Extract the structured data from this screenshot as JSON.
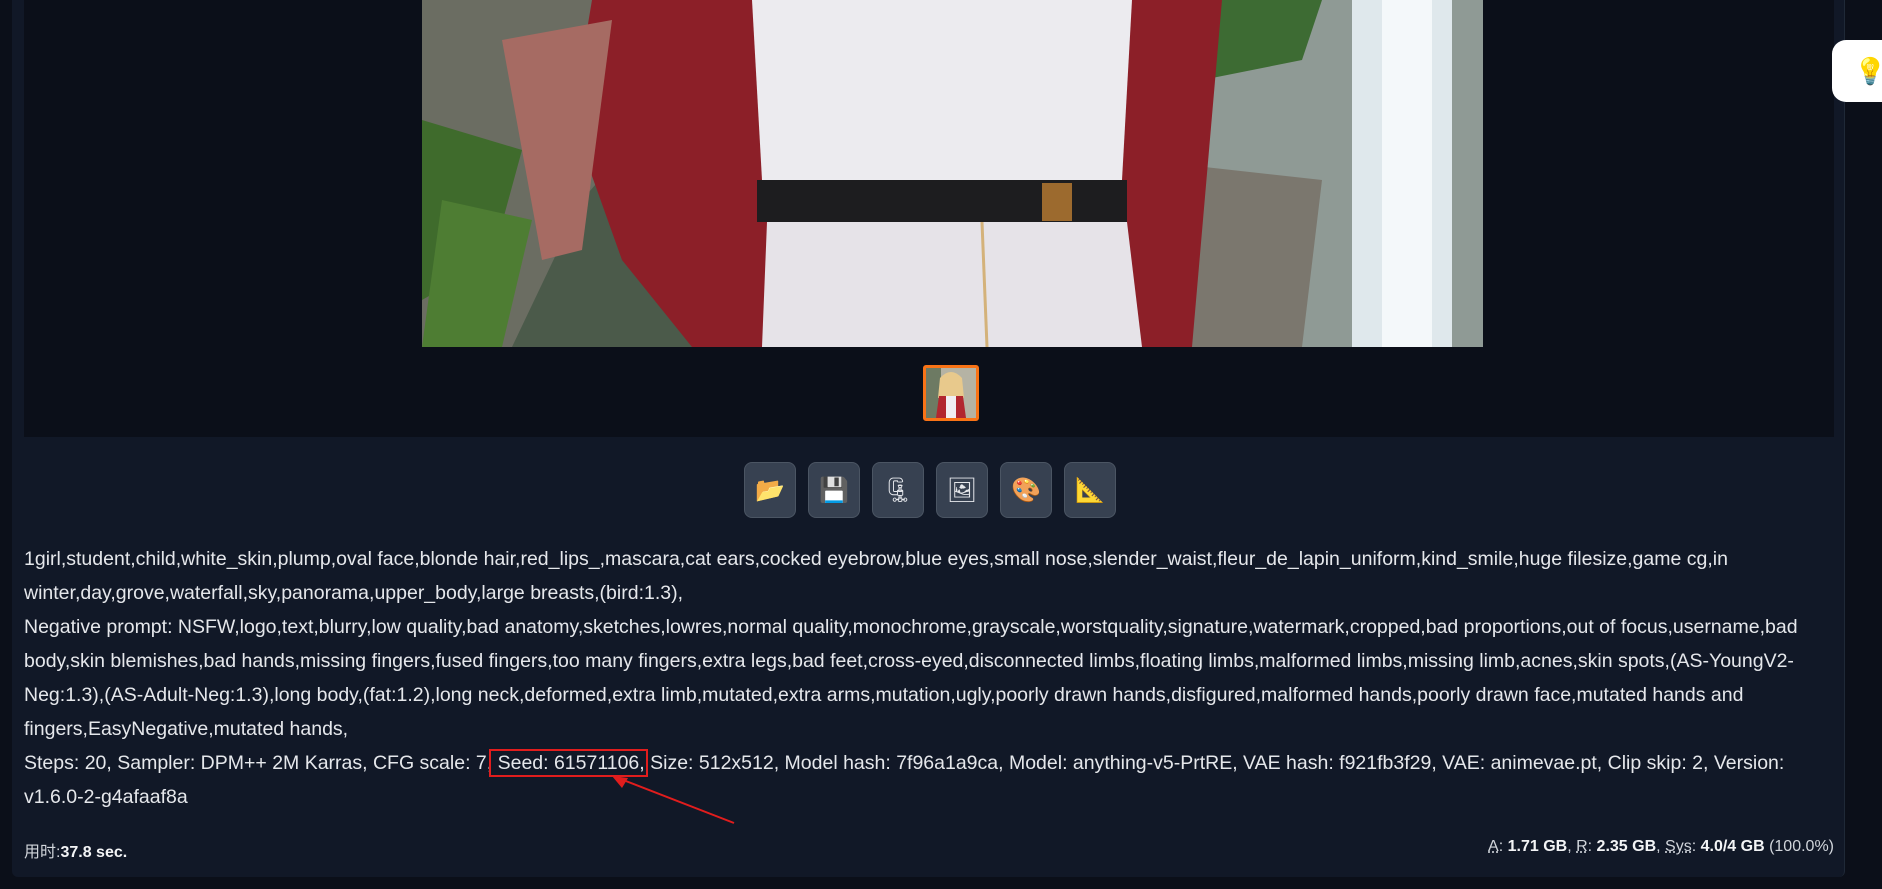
{
  "toolbar": {
    "buttons": [
      {
        "name": "open-folder-button",
        "icon": "📂",
        "icon_name": "folder-icon"
      },
      {
        "name": "save-button",
        "icon": "💾",
        "icon_name": "floppy-disk-icon"
      },
      {
        "name": "zip-button",
        "icon": "🗜",
        "icon_name": "zip-archive-icon"
      },
      {
        "name": "send-to-img2img-button",
        "icon": "🖼",
        "icon_name": "picture-icon"
      },
      {
        "name": "send-to-inpaint-button",
        "icon": "🎨",
        "icon_name": "palette-icon"
      },
      {
        "name": "send-to-extras-button",
        "icon": "📐",
        "icon_name": "triangle-ruler-icon"
      }
    ]
  },
  "infotext": {
    "prompt": "1girl,student,child,white_skin,plump,oval face,blonde hair,red_lips_,mascara,cat ears,cocked eyebrow,blue eyes,small nose,slender_waist,fleur_de_lapin_uniform,kind_smile,huge filesize,game cg,in winter,day,grove,waterfall,sky,panorama,upper_body,large breasts,(bird:1.3),",
    "negative_prompt": "Negative prompt: NSFW,logo,text,blurry,low quality,bad anatomy,sketches,lowres,normal quality,monochrome,grayscale,worstquality,signature,watermark,cropped,bad proportions,out of focus,username,bad body,skin blemishes,bad hands,missing fingers,fused fingers,too many fingers,extra legs,bad feet,cross-eyed,disconnected limbs,floating limbs,malformed limbs,missing limb,acnes,skin spots,(AS-YoungV2-Neg:1.3),(AS-Adult-Neg:1.3),long body,(fat:1.2),long neck,deformed,extra limb,mutated,extra arms,mutation,ugly,poorly drawn hands,disfigured,malformed hands,poorly drawn face,mutated hands and fingers,EasyNegative,mutated hands,",
    "params_before": "Steps: 20, Sampler: DPM++ 2M Karras, CFG scale: 7,",
    "seed": " Seed: 61571106,",
    "params_after": " Size: 512x512, Model hash: 7f96a1a9ca, Model: anything-v5-PrtRE, VAE hash: f921fb3f29, VAE: animevae.pt, Clip skip: 2, Version: v1.6.0-2-g4afaaf8a"
  },
  "footer": {
    "time_label": "用时:",
    "time_value": "37.8 sec.",
    "vram_a_label": "A",
    "vram_a_value": "1.71 GB",
    "vram_r_label": "R",
    "vram_r_value": "2.35 GB",
    "vram_sys_label": "Sys",
    "vram_sys_value": "4.0/4 GB",
    "vram_percent": "(100.0%)"
  },
  "side_widget": {
    "icon": "💡",
    "icon_name": "lightbulb-icon"
  },
  "colors": {
    "accent_orange": "#f97316",
    "highlight_red": "#e11d1d",
    "background": "#0b0f19",
    "panel": "#111827"
  }
}
